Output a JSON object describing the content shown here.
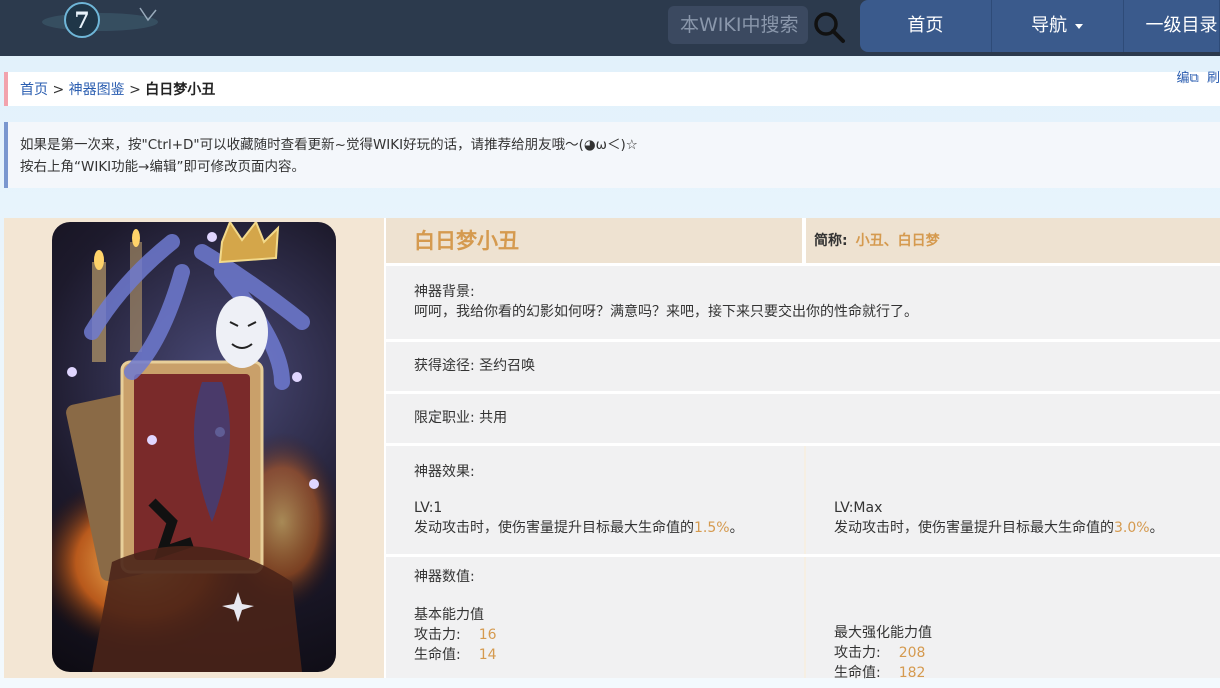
{
  "search": {
    "placeholder": "本WIKI中搜索"
  },
  "nav": {
    "home": "首页",
    "navigation": "导航",
    "level1": "一级目录"
  },
  "breadcrumb": {
    "home": "首页",
    "sep1": ">",
    "section": "神器图鉴",
    "sep2": ">",
    "current": "白日梦小丑"
  },
  "edit_links": {
    "edit": "编",
    "refresh": "刷"
  },
  "notice": {
    "line1": "如果是第一次来，按\"Ctrl+D\"可以收藏随时查看更新~觉得WIKI好玩的话，请推荐给朋友哦～(◕ω＜)☆",
    "line2": "按右上角“WIKI功能→编辑”即可修改页面内容。"
  },
  "artifact": {
    "name": "白日梦小丑",
    "alias_label": "简称:",
    "alias_value": "小丑、白日梦",
    "background_label": "神器背景:",
    "background_text": "呵呵，我给你看的幻影如何呀？满意吗？来吧，接下来只要交出你的性命就行了。",
    "source": "获得途径: 圣约召唤",
    "job": "限定职业: 共用",
    "effect_label": "神器效果:",
    "lv1_label": "LV:1",
    "lv1_text": "发动攻击时，使伤害量提升目标最大生命值的",
    "lv1_value": "1.5%",
    "lv1_end": "。",
    "lvmax_label": "LV:Max",
    "lvmax_text": "发动攻击时，使伤害量提升目标最大生命值的",
    "lvmax_value": "3.0%",
    "lvmax_end": "。",
    "stats_label": "神器数值:",
    "base_label": "基本能力值",
    "max_label": "最大强化能力值",
    "atk_label": "攻击力:",
    "hp_label": "生命值:",
    "base_atk": "16",
    "base_hp": "14",
    "max_atk": "208",
    "max_hp": "182"
  }
}
